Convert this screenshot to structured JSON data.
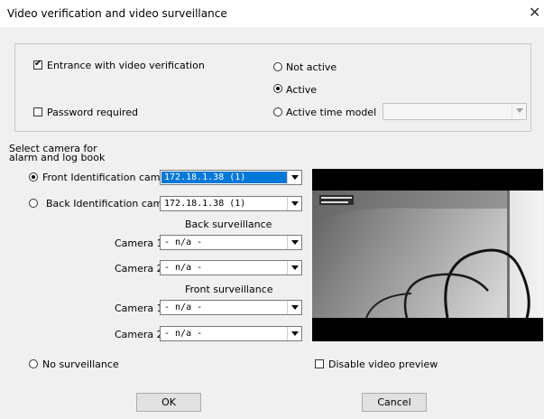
{
  "window": {
    "title": "Video verification and video surveillance"
  },
  "options": {
    "entrance_label": "Entrance with video verification",
    "password_label": "Password required",
    "not_active_label": "Not active",
    "active_label": "Active",
    "active_time_model_label": "Active time model",
    "selected_mode": "Active"
  },
  "select_camera": {
    "heading_line1": "Select camera for",
    "heading_line2": "alarm and log book",
    "front_label": "Front Identification camera:",
    "front_value": "172.18.1.38 (1)",
    "back_label": "Back Identification camera:",
    "back_value": "172.18.1.38 (1)",
    "back_surveillance_label": "Back surveillance",
    "front_surveillance_label": "Front surveillance",
    "camera1_label": "Camera 1:",
    "camera2_label": "Camera 2:",
    "back_cam1_value": "- n/a -",
    "back_cam2_value": "- n/a -",
    "front_cam1_value": "- n/a -",
    "front_cam2_value": "- n/a -"
  },
  "no_surveillance_label": "No surveillance",
  "disable_preview_label": "Disable video preview",
  "buttons": {
    "ok": "OK",
    "cancel": "Cancel"
  },
  "colors": {
    "selection": "#0078d7",
    "dialog_bg": "#f0f0f0"
  }
}
